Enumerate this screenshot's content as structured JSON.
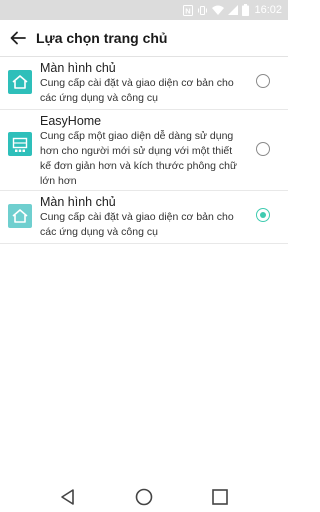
{
  "status_bar": {
    "time": "16:02",
    "icons": [
      "nfc-icon",
      "vibrate-icon",
      "wifi-icon",
      "signal-icon",
      "battery-icon"
    ]
  },
  "app_bar": {
    "title": "Lựa chọn trang chủ",
    "back_icon": "back-arrow-icon"
  },
  "home_options": [
    {
      "title": "Màn hình chủ",
      "description": "Cung cấp cài đặt và giao diện cơ bản cho các ứng dụng và công cụ",
      "icon": "home-icon",
      "selected": false
    },
    {
      "title": "EasyHome",
      "description": "Cung cấp một giao diện dễ dàng sử dụng hơn cho người mới sử dụng với một thiết kế đơn giản hơn và kích thước phông chữ lớn hơn",
      "icon": "easyhome-icon",
      "selected": false
    },
    {
      "title": "Màn hình chủ",
      "description": "Cung cấp cài đặt và giao diện cơ bản cho các ứng dụng và công cụ",
      "icon": "home-icon",
      "selected": true
    }
  ],
  "colors": {
    "accent": "#3fcbb0",
    "icon_teal": "#2ebfba",
    "icon_teal_light": "#6fcfcf",
    "status_bar": "#dcdcdc"
  },
  "nav_bar": {
    "buttons": [
      "back-triangle-icon",
      "home-circle-icon",
      "recents-square-icon"
    ]
  }
}
